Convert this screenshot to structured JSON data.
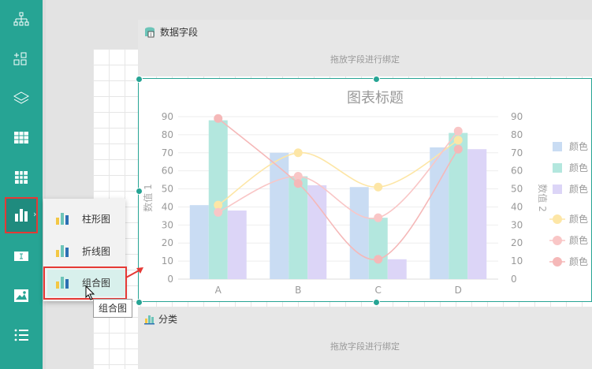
{
  "colors": {
    "sidebar": "#26a494",
    "accent_red": "#e53935",
    "bar1": "#c9dcf3",
    "bar2": "#b3e7de",
    "bar3": "#dcd5f7",
    "line1": "#fde6a6",
    "line2": "#f9c6c6",
    "line3": "#f5b8b8"
  },
  "sidebar": {
    "items": [
      {
        "icon": "org-tree-icon"
      },
      {
        "icon": "grid-add-icon"
      },
      {
        "icon": "layers-icon"
      },
      {
        "icon": "table-icon"
      },
      {
        "icon": "apps-grid-icon"
      },
      {
        "icon": "bar-chart-icon"
      },
      {
        "icon": "text-box-icon"
      },
      {
        "icon": "image-icon"
      },
      {
        "icon": "list-icon"
      }
    ]
  },
  "data_zone": {
    "title": "数据字段",
    "hint": "拖放字段进行绑定"
  },
  "category_zone": {
    "title": "分类",
    "hint": "拖放字段进行绑定"
  },
  "chart_menu": {
    "items": [
      "柱形图",
      "折线图",
      "组合图"
    ],
    "tooltip": "组合图"
  },
  "chart_data": {
    "type": "bar",
    "title": "图表标题",
    "categories": [
      "A",
      "B",
      "C",
      "D"
    ],
    "ylabel": "数值 1",
    "y2label": "数值 2",
    "ylim": [
      0,
      90
    ],
    "yticks": [
      0,
      10,
      20,
      30,
      40,
      50,
      60,
      70,
      80,
      90
    ],
    "legend_position": "right",
    "series": [
      {
        "name": "颜色",
        "kind": "bar",
        "values": [
          41,
          70,
          51,
          73
        ]
      },
      {
        "name": "颜色",
        "kind": "bar",
        "values": [
          88,
          57,
          34,
          81
        ]
      },
      {
        "name": "颜色",
        "kind": "bar",
        "values": [
          38,
          52,
          11,
          72
        ]
      },
      {
        "name": "颜色",
        "kind": "line",
        "values": [
          41,
          70,
          51,
          77
        ]
      },
      {
        "name": "颜色",
        "kind": "line",
        "values": [
          37,
          57,
          34,
          82
        ]
      },
      {
        "name": "颜色",
        "kind": "line",
        "values": [
          89,
          53,
          11,
          72
        ]
      }
    ]
  }
}
